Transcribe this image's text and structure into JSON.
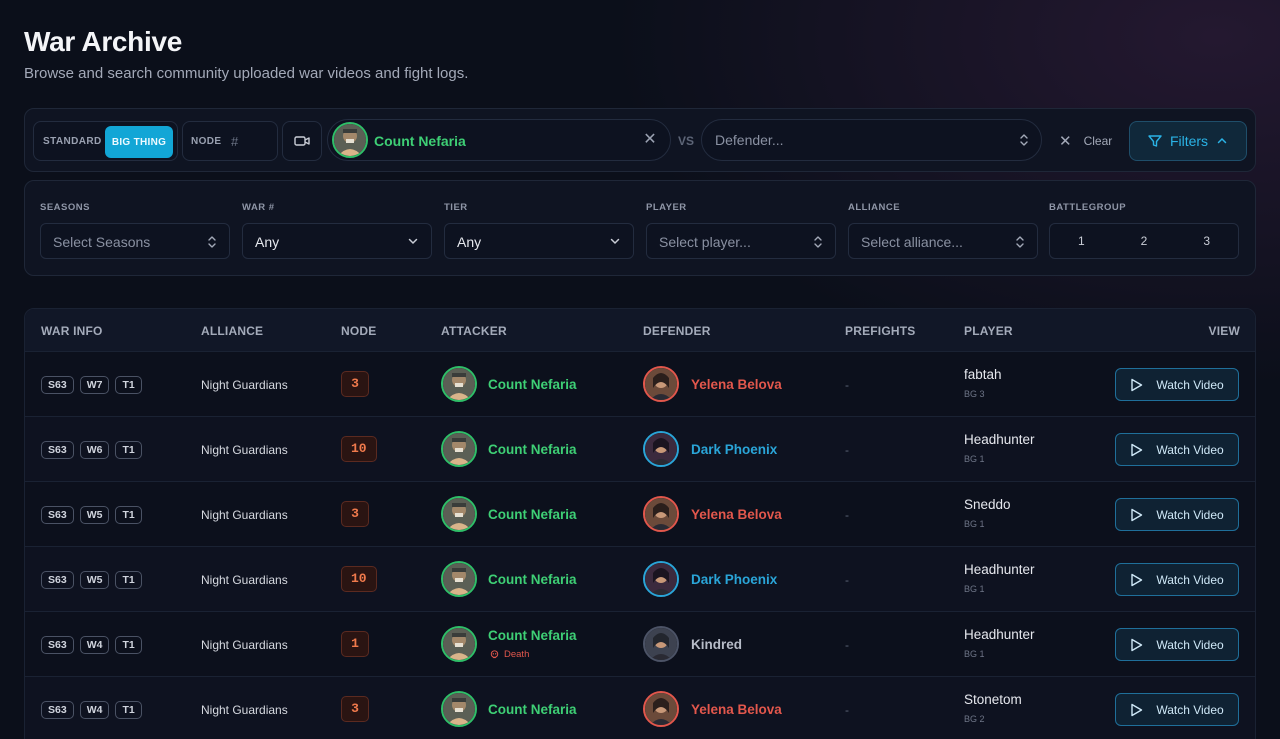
{
  "page": {
    "title": "War Archive",
    "subtitle": "Browse and search community uploaded war videos and fight logs."
  },
  "search": {
    "mode_standard": "STANDARD",
    "mode_big_thing": "BIG THING",
    "node_label": "NODE",
    "node_placeholder": "#",
    "attacker": "Count Nefaria",
    "vs": "VS",
    "defender_placeholder": "Defender...",
    "clear": "Clear",
    "filters": "Filters"
  },
  "filters": {
    "seasons": {
      "label": "SEASONS",
      "placeholder": "Select Seasons"
    },
    "war": {
      "label": "WAR #",
      "value": "Any"
    },
    "tier": {
      "label": "TIER",
      "value": "Any"
    },
    "player": {
      "label": "PLAYER",
      "placeholder": "Select player..."
    },
    "alliance": {
      "label": "ALLIANCE",
      "placeholder": "Select alliance..."
    },
    "battlegroup": {
      "label": "BATTLEGROUP",
      "options": [
        "1",
        "2",
        "3"
      ]
    }
  },
  "table": {
    "headers": {
      "war_info": "WAR INFO",
      "alliance": "ALLIANCE",
      "node": "NODE",
      "attacker": "ATTACKER",
      "defender": "DEFENDER",
      "prefights": "PREFIGHTS",
      "player": "PLAYER",
      "view": "VIEW"
    },
    "watch_label": "Watch Video",
    "rows": [
      {
        "season": "S63",
        "war": "W7",
        "tier": "T1",
        "alliance": "Night Guardians",
        "node": "3",
        "attacker": "Count Nefaria",
        "death": "",
        "defender": "Yelena Belova",
        "defender_color": "#e2574c",
        "prefights": "-",
        "player": "fabtah",
        "bg": "BG 3"
      },
      {
        "season": "S63",
        "war": "W6",
        "tier": "T1",
        "alliance": "Night Guardians",
        "node": "10",
        "attacker": "Count Nefaria",
        "death": "",
        "defender": "Dark Phoenix",
        "defender_color": "#2aa5d8",
        "prefights": "-",
        "player": "Headhunter",
        "bg": "BG 1"
      },
      {
        "season": "S63",
        "war": "W5",
        "tier": "T1",
        "alliance": "Night Guardians",
        "node": "3",
        "attacker": "Count Nefaria",
        "death": "",
        "defender": "Yelena Belova",
        "defender_color": "#e2574c",
        "prefights": "-",
        "player": "Sneddo",
        "bg": "BG 1"
      },
      {
        "season": "S63",
        "war": "W5",
        "tier": "T1",
        "alliance": "Night Guardians",
        "node": "10",
        "attacker": "Count Nefaria",
        "death": "",
        "defender": "Dark Phoenix",
        "defender_color": "#2aa5d8",
        "prefights": "-",
        "player": "Headhunter",
        "bg": "BG 1"
      },
      {
        "season": "S63",
        "war": "W4",
        "tier": "T1",
        "alliance": "Night Guardians",
        "node": "1",
        "attacker": "Count Nefaria",
        "death": "Death",
        "defender": "Kindred",
        "defender_color": "#b7bcc8",
        "prefights": "-",
        "player": "Headhunter",
        "bg": "BG 1"
      },
      {
        "season": "S63",
        "war": "W4",
        "tier": "T1",
        "alliance": "Night Guardians",
        "node": "3",
        "attacker": "Count Nefaria",
        "death": "",
        "defender": "Yelena Belova",
        "defender_color": "#e2574c",
        "prefights": "-",
        "player": "Stonetom",
        "bg": "BG 2"
      }
    ]
  }
}
